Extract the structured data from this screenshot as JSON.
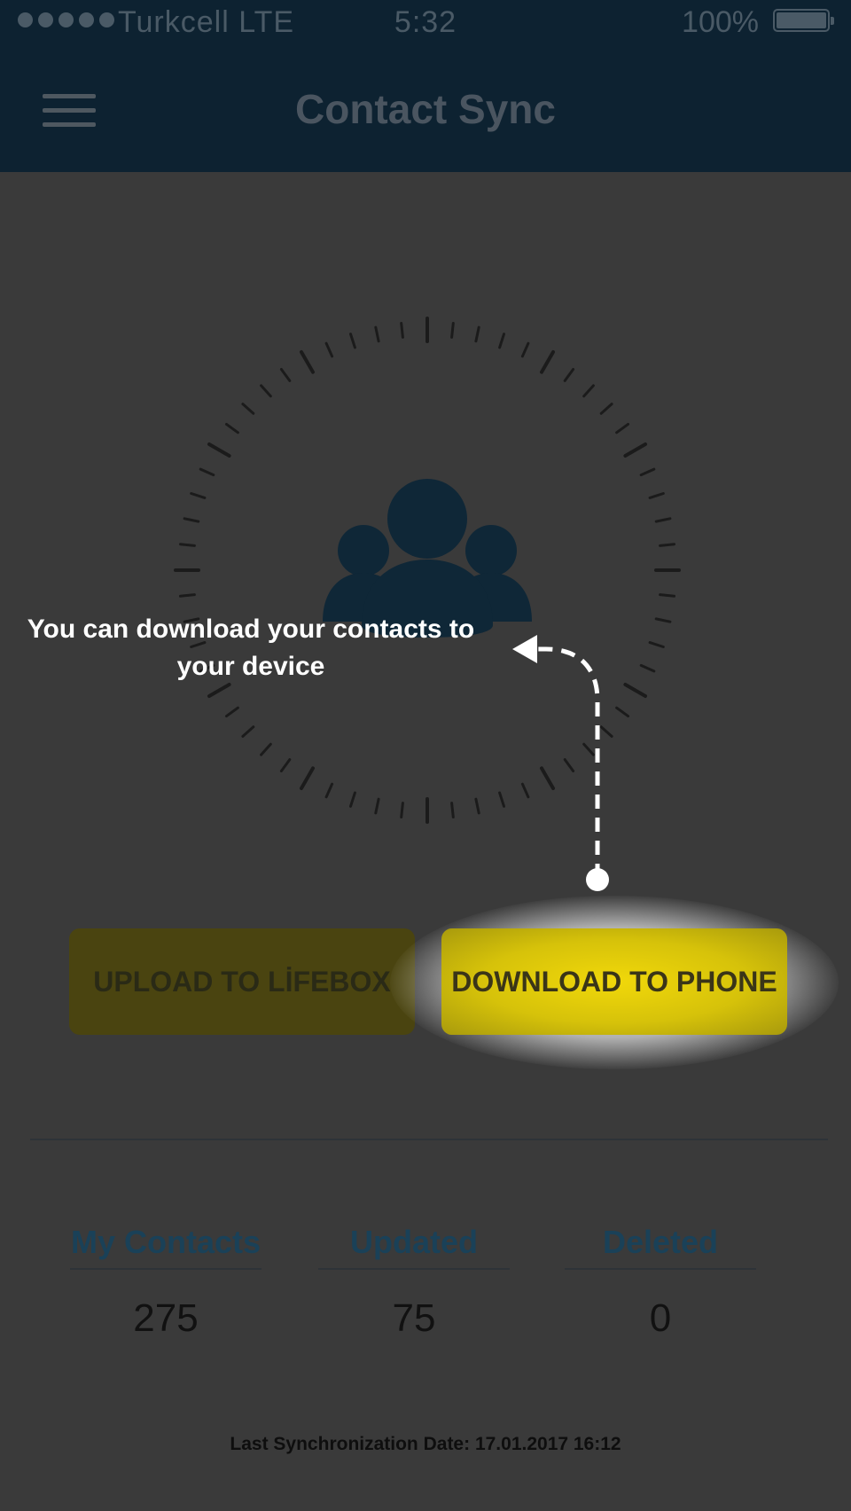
{
  "status_bar": {
    "signal_dots": 5,
    "carrier": "Turkcell  LTE",
    "time": "5:32",
    "battery_percent": "100%",
    "battery_level": 1.0
  },
  "app_bar": {
    "menu_icon": "hamburger-menu-icon",
    "title": "Contact Sync"
  },
  "illustration": {
    "center_icon": "contacts-group-icon",
    "ring": "tick-dial"
  },
  "coach_mark": {
    "text": "You can download your contacts to your device",
    "arrow_icon": "dashed-arrow-icon"
  },
  "actions": {
    "upload_label": "UPLOAD TO LİFEBOX",
    "download_label": "DOWNLOAD TO PHONE"
  },
  "stats": {
    "contacts_label": "My Contacts",
    "contacts_value": "275",
    "updated_label": "Updated",
    "updated_value": "75",
    "deleted_label": "Deleted",
    "deleted_value": "0"
  },
  "footer": {
    "last_sync": "Last Synchronization Date: 17.01.2017 16:12"
  },
  "colors": {
    "header_bg": "#0d2231",
    "overlay_bg": "#3a3a3a",
    "accent_yellow": "#f1d80a",
    "stat_label": "#1a4158"
  }
}
